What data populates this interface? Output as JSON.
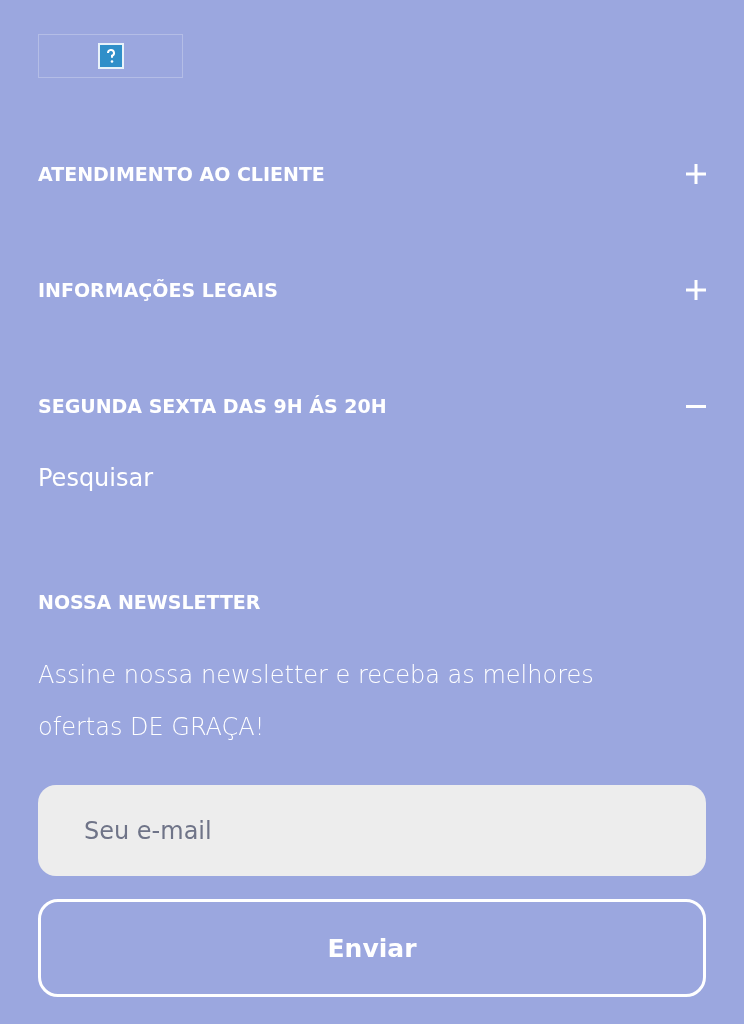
{
  "logo": {
    "kind": "broken-image"
  },
  "sections": [
    {
      "title": "ATENDIMENTO AO CLIENTE",
      "expanded": false
    },
    {
      "title": "INFORMAÇÕES LEGAIS",
      "expanded": false
    },
    {
      "title": "SEGUNDA SEXTA DAS 9H ÁS 20H",
      "expanded": true,
      "links": [
        "Pesquisar"
      ]
    }
  ],
  "newsletter": {
    "title": "NOSSA NEWSLETTER",
    "text": "Assine nossa newsletter e receba as melhores ofertas DE GRAÇA!",
    "email": {
      "placeholder": "Seu e-mail"
    },
    "button": "Enviar"
  }
}
